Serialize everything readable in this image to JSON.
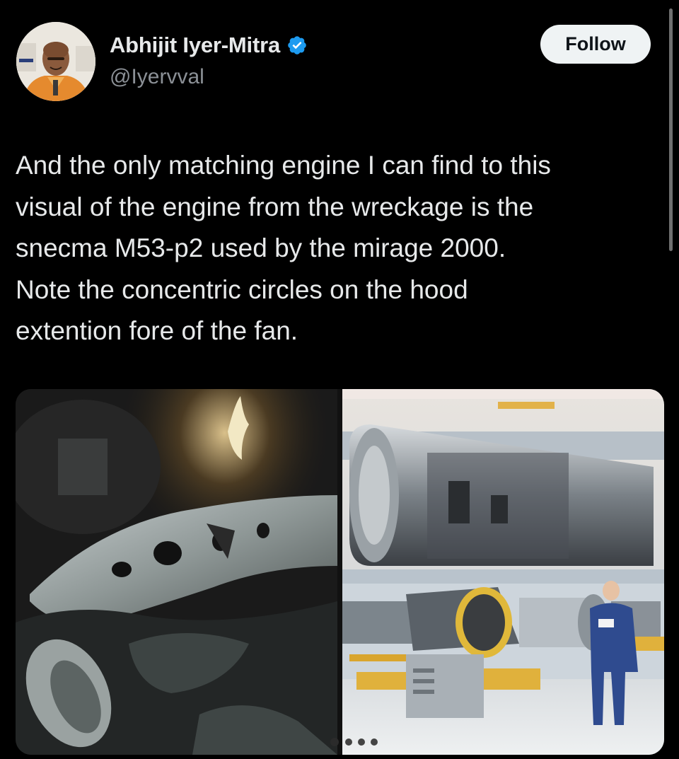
{
  "author": {
    "name": "Abhijit Iyer-Mitra",
    "handle": "@Iyervval",
    "verified": true,
    "avatar_icon": "profile-photo"
  },
  "follow_button": {
    "label": "Follow"
  },
  "tweet": {
    "text": "And the only matching engine I can find to this\nvisual of the engine from the wreckage is the\nsnecma M53-p2 used by the mirage 2000.\nNote the concentric circles on the hood\nextention fore of the fan."
  },
  "media": [
    {
      "kind": "photo",
      "subject": "engine-wreckage-photo"
    },
    {
      "kind": "photo",
      "subject": "engine-hangar-photo"
    }
  ],
  "colors": {
    "background": "#000000",
    "text": "#e7e9ea",
    "secondary_text": "#8b9096",
    "verified_blue": "#1d9bf0",
    "follow_bg": "#eff3f4"
  }
}
